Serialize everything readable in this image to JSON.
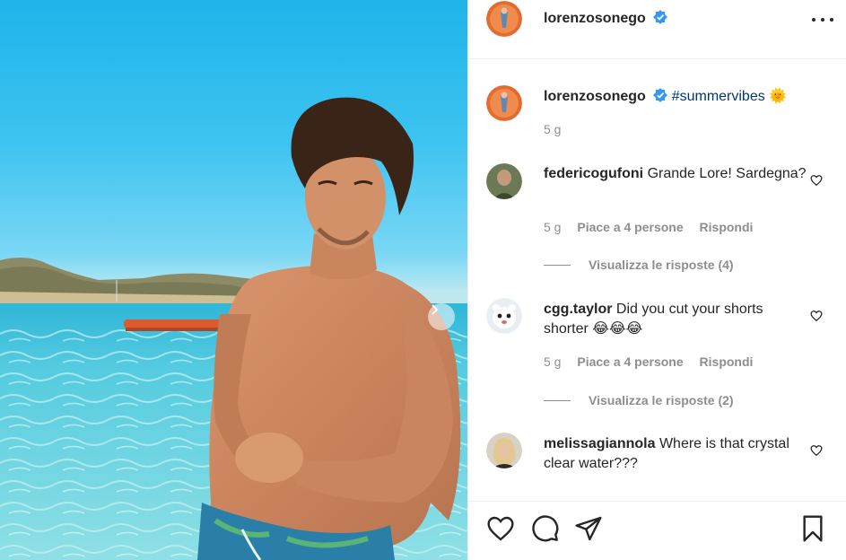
{
  "post": {
    "username": "lorenzosonego",
    "verified": true,
    "caption_hashtag": "#summervibes",
    "caption_emoji": "🌞",
    "time_ago": "5 g"
  },
  "comments": [
    {
      "username": "federicogufoni",
      "text": "Grande Lore! Sardegna?",
      "time_ago": "5 g",
      "likes": "Piace a 4 persone",
      "reply_label": "Rispondi",
      "view_replies": "Visualizza le risposte (4)"
    },
    {
      "username": "cgg.taylor",
      "text": "Did you cut your shorts shorter 😂😂😂",
      "time_ago": "5 g",
      "likes": "Piace a 4 persone",
      "reply_label": "Rispondi",
      "view_replies": "Visualizza le risposte (2)"
    },
    {
      "username": "melissagiannola",
      "text": "Where is that crystal clear water???"
    }
  ],
  "actions": {
    "icons": [
      "heart-icon",
      "comment-icon",
      "share-icon",
      "bookmark-icon"
    ]
  },
  "colors": {
    "verified": "#3897f0",
    "hashtag": "#00376b",
    "muted": "#8e8e8e",
    "text": "#262626"
  }
}
